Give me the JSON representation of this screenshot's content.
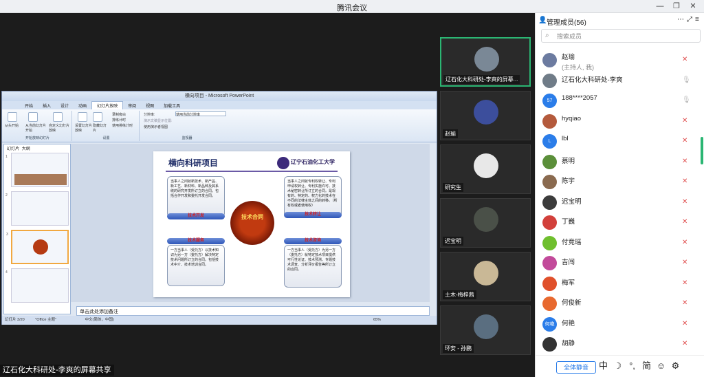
{
  "app": {
    "title": "腾讯会议"
  },
  "ppt": {
    "window_title": "横向项目 - Microsoft PowerPoint",
    "tabs": [
      "开始",
      "插入",
      "设计",
      "动画",
      "幻灯片放映",
      "审阅",
      "视图",
      "加载工具"
    ],
    "active_tab": "幻灯片放映",
    "ribbon_groups": [
      "开始放映幻灯片",
      "设置",
      "监视器"
    ],
    "ribbon_items": [
      "从头开始",
      "从当前幻灯片开始",
      "自定义幻灯片放映",
      "设置幻灯片放映",
      "隐藏幻灯片",
      "录制旁白",
      "排练计时",
      "使用排练计时",
      "分辨率:",
      "使用当前分辨率",
      "演示文稿显示位置:",
      "使用演示者视图"
    ],
    "panel_tabs": [
      "幻灯片",
      "大纲"
    ],
    "notes_placeholder": "单击此处添加备注",
    "status": {
      "slide": "幻灯片 3/20",
      "theme": "\"Office 主题\"",
      "lang": "中文(简体，中国)",
      "zoom": "65%"
    },
    "slide": {
      "title": "横向科研项目",
      "university": "辽宁石油化工大学",
      "center": "技术合同",
      "box_tl": "当事人之间就新技术、新产品、新工艺、新材料、新品种及其系统的研究开发所订立的合同。包括合作开发和委托开发合同。",
      "band_tl": "技术开发",
      "box_tr": "当事人之间就专利权转让、专利申请权转让、专利实施许可、技术秘密转让所订立的合同。是现有的、特定的、权力化的技术在不同的法律主体之间的转移。（所有权或者使用权）",
      "band_tr": "技术转让",
      "band_bl": "技术服务",
      "box_bl": "一方当事人（受托方）以技术知识为另一方（委托方）解决特定技术问题所订立的合同。包括技术中介、技术培训合同。",
      "band_br": "技术咨询",
      "box_br": "一方当事人（受托方）为另一方（委托方）就特定技术项目提供可行性论证、技术预测、专题技术调查、分析评价报告等所订立的合同。"
    }
  },
  "share_label": "辽石化大科研处-李爽的屏幕共享",
  "videos": [
    {
      "name": "辽石化大科研处-李爽的屏幕..."
    },
    {
      "name": "赵瑜"
    },
    {
      "name": "研究生"
    },
    {
      "name": "迟宝明"
    },
    {
      "name": "土木-梅梓茜"
    },
    {
      "name": "环安 - 孙鹏"
    }
  ],
  "members_panel": {
    "title": "管理成员(56)",
    "search_placeholder": "搜索成员",
    "members": [
      {
        "name": "赵瑜",
        "sub": "(主持人, 我)",
        "avatar": "",
        "color": "#6c7ba0",
        "mic": "muted"
      },
      {
        "name": "辽石化大科研处-李爽",
        "sub": "",
        "avatar": "",
        "color": "#707c88",
        "mic": "on"
      },
      {
        "name": "188****2057",
        "sub": "",
        "avatar": "57",
        "color": "#2b7de9",
        "mic": "on"
      },
      {
        "name": "hyqiao",
        "sub": "",
        "avatar": "",
        "color": "#b45a3c",
        "mic": "muted"
      },
      {
        "name": "lbl",
        "sub": "",
        "avatar": "L",
        "color": "#2b7de9",
        "mic": "muted"
      },
      {
        "name": "蔡明",
        "sub": "",
        "avatar": "",
        "color": "#5b8f3a",
        "mic": "muted"
      },
      {
        "name": "陈宇",
        "sub": "",
        "avatar": "",
        "color": "#8a6a4f",
        "mic": "muted"
      },
      {
        "name": "迟宝明",
        "sub": "",
        "avatar": "",
        "color": "#3c3c3c",
        "mic": "muted"
      },
      {
        "name": "丁巍",
        "sub": "",
        "avatar": "",
        "color": "#d2403b",
        "mic": "muted"
      },
      {
        "name": "付竞瑶",
        "sub": "",
        "avatar": "",
        "color": "#6fbf2e",
        "mic": "muted"
      },
      {
        "name": "吉闯",
        "sub": "",
        "avatar": "",
        "color": "#c24a9a",
        "mic": "muted"
      },
      {
        "name": "梅军",
        "sub": "",
        "avatar": "",
        "color": "#e0502b",
        "mic": "muted"
      },
      {
        "name": "何俊新",
        "sub": "",
        "avatar": "",
        "color": "#e8692f",
        "mic": "muted"
      },
      {
        "name": "何艳",
        "sub": "",
        "avatar": "何艳",
        "color": "#2b7de9",
        "mic": "muted"
      },
      {
        "name": "胡静",
        "sub": "",
        "avatar": "",
        "color": "#333333",
        "mic": "muted"
      }
    ],
    "mute_all": "全体静音",
    "ime": [
      "中",
      "☽",
      "°,",
      "简",
      "☺",
      "⚙"
    ]
  }
}
